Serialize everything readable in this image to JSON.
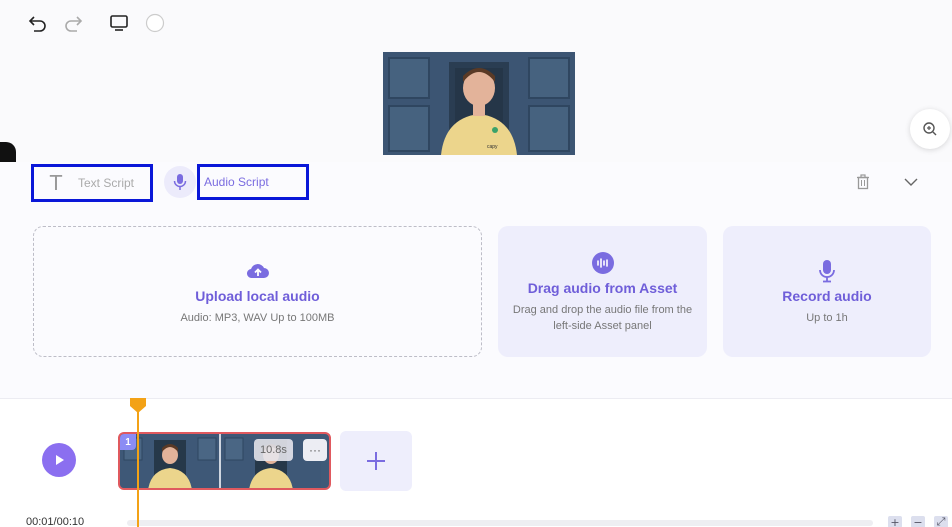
{
  "toolbar": {
    "undo_icon": "undo-icon",
    "redo_icon": "redo-icon",
    "monitor_icon": "monitor-icon",
    "color_icon": "color-circle-icon"
  },
  "script_tabs": {
    "text_script_label": "Text Script",
    "audio_script_label": "Audio Script",
    "highlight_color": "#0a17d8",
    "accent_color": "#6f5ed9"
  },
  "cards": {
    "upload": {
      "title": "Upload local audio",
      "desc": "Audio: MP3, WAV Up to 100MB"
    },
    "drag": {
      "title": "Drag audio from Asset",
      "desc": "Drag and drop the audio file from the left-side Asset panel"
    },
    "record": {
      "title": "Record audio",
      "desc": "Up to 1h"
    }
  },
  "timeline": {
    "clip_number": "1",
    "clip_duration": "10.8s",
    "clip_more": "···",
    "time": "00:01/00:10",
    "zoom_in": "+",
    "zoom_out": "−",
    "fit": "⤢",
    "playhead_color": "#f3a216",
    "clip_border_color": "#e0595e"
  }
}
